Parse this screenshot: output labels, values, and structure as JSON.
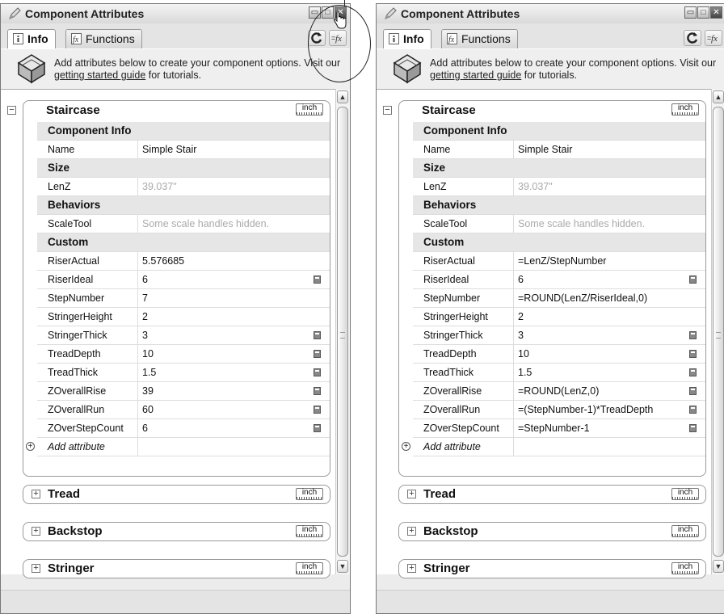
{
  "window": {
    "title": "Component Attributes",
    "buttons": [
      "▭",
      "□",
      "✕"
    ]
  },
  "tabs": {
    "info": "Info",
    "functions": "Functions"
  },
  "header": {
    "text_before": "Add attributes below to create your component options. Visit our ",
    "link": "getting started guide",
    "text_after": " for tutorials."
  },
  "unit_label": "inch",
  "add_attribute": "Add attribute",
  "panels": [
    {
      "id": "formatted-values",
      "group": "Staircase",
      "sections": {
        "component_info": "Component Info",
        "size": "Size",
        "behaviors": "Behaviors",
        "custom": "Custom"
      },
      "name_label": "Name",
      "name_value": "Simple Stair",
      "lenz_label": "LenZ",
      "lenz_value": "39.037\"",
      "scaletool_label": "ScaleTool",
      "scaletool_value": "Some scale handles hidden.",
      "custom": [
        {
          "name": "RiserActual",
          "value": "5.576685",
          "calc": false
        },
        {
          "name": "RiserIdeal",
          "value": "6",
          "calc": true
        },
        {
          "name": "StepNumber",
          "value": "7",
          "calc": false
        },
        {
          "name": "StringerHeight",
          "value": "2",
          "calc": false
        },
        {
          "name": "StringerThick",
          "value": "3",
          "calc": true
        },
        {
          "name": "TreadDepth",
          "value": "10",
          "calc": true
        },
        {
          "name": "TreadThick",
          "value": "1.5",
          "calc": true
        },
        {
          "name": "ZOverallRise",
          "value": "39",
          "calc": true
        },
        {
          "name": "ZOverallRun",
          "value": "60",
          "calc": true
        },
        {
          "name": "ZOverStepCount",
          "value": "6",
          "calc": true
        }
      ],
      "collapsed": [
        "Tread",
        "Backstop",
        "Stringer"
      ]
    },
    {
      "id": "formula-view",
      "group": "Staircase",
      "sections": {
        "component_info": "Component Info",
        "size": "Size",
        "behaviors": "Behaviors",
        "custom": "Custom"
      },
      "name_label": "Name",
      "name_value": "Simple Stair",
      "lenz_label": "LenZ",
      "lenz_value": "39.037\"",
      "scaletool_label": "ScaleTool",
      "scaletool_value": "Some scale handles hidden.",
      "custom": [
        {
          "name": "RiserActual",
          "value": "=LenZ/StepNumber",
          "calc": false
        },
        {
          "name": "RiserIdeal",
          "value": "6",
          "calc": true
        },
        {
          "name": "StepNumber",
          "value": "=ROUND(LenZ/RiserIdeal,0)",
          "calc": false
        },
        {
          "name": "StringerHeight",
          "value": "2",
          "calc": false
        },
        {
          "name": "StringerThick",
          "value": "3",
          "calc": true
        },
        {
          "name": "TreadDepth",
          "value": "10",
          "calc": true
        },
        {
          "name": "TreadThick",
          "value": "1.5",
          "calc": true
        },
        {
          "name": "ZOverallRise",
          "value": "=ROUND(LenZ,0)",
          "calc": true
        },
        {
          "name": "ZOverallRun",
          "value": "=(StepNumber-1)*TreadDepth",
          "calc": true
        },
        {
          "name": "ZOverStepCount",
          "value": "=StepNumber-1",
          "calc": true
        }
      ],
      "collapsed": [
        "Tread",
        "Backstop",
        "Stringer"
      ]
    }
  ]
}
